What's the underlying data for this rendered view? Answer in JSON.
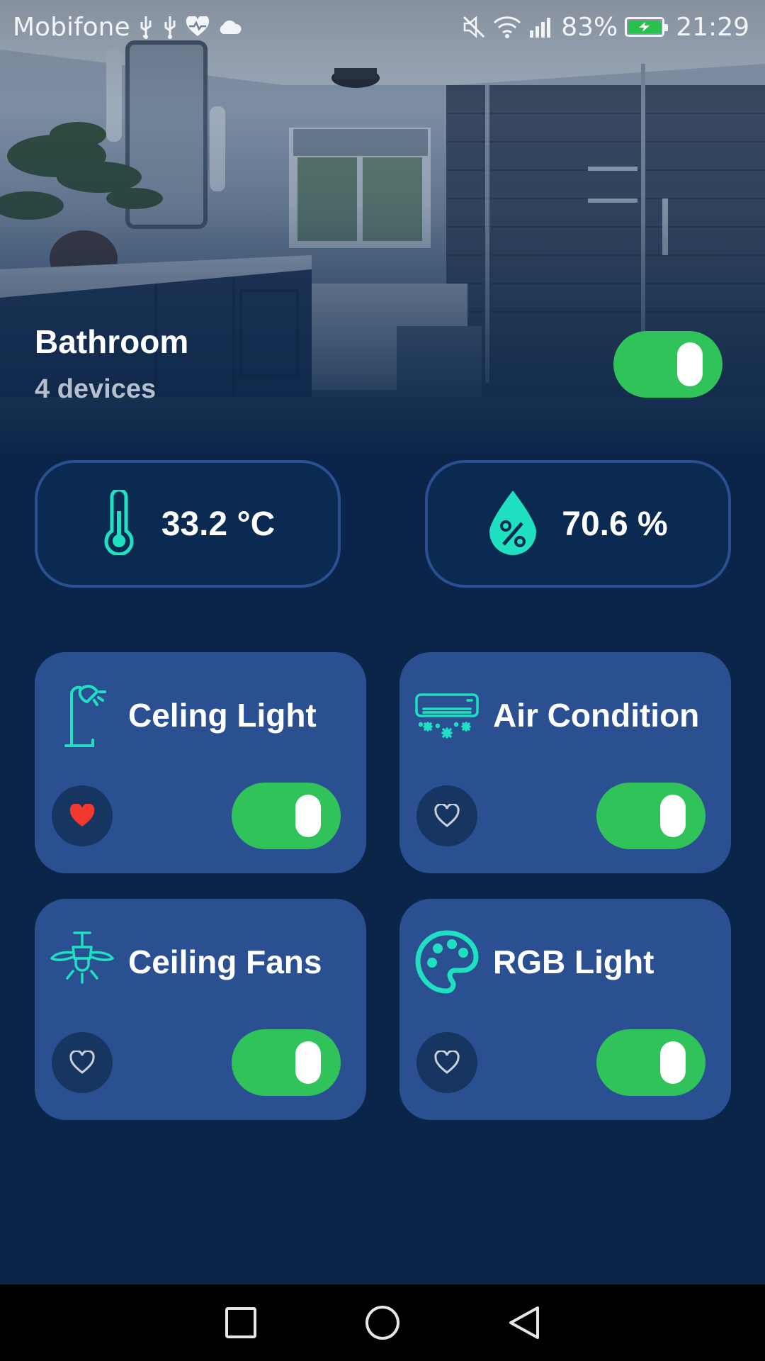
{
  "status_bar": {
    "carrier": "Mobifone",
    "battery": "83%",
    "time": "21:29",
    "icons": [
      "usb-icon",
      "usb-icon",
      "heart-rate-icon",
      "cloud-icon",
      "mute-icon",
      "wifi-icon",
      "signal-icon",
      "battery-charging-icon"
    ]
  },
  "room": {
    "name": "Bathroom",
    "device_count": "4 devices",
    "power_on": true
  },
  "sensors": {
    "temperature": {
      "icon": "thermometer-icon",
      "value": "33.2 °C"
    },
    "humidity": {
      "icon": "humidity-drop-icon",
      "value": "70.6 %"
    }
  },
  "devices": [
    {
      "name": "Celing Light",
      "icon": "ceiling-light-icon",
      "favorite": true,
      "on": true
    },
    {
      "name": "Air Condition",
      "icon": "air-conditioner-icon",
      "favorite": false,
      "on": true
    },
    {
      "name": "Ceiling Fans",
      "icon": "ceiling-fan-icon",
      "favorite": false,
      "on": true
    },
    {
      "name": "RGB Light",
      "icon": "palette-icon",
      "favorite": false,
      "on": true
    }
  ],
  "navigation": {
    "buttons": [
      "recent-apps-icon",
      "home-icon",
      "back-icon"
    ]
  },
  "colors": {
    "background": "#0a2548",
    "card": "#2a5092",
    "toggle_on": "#2fc35a",
    "accent_icon": "#1fe0c0",
    "favorite_active": "#f2392f",
    "favorite_inactive": "#c8d0dc"
  }
}
